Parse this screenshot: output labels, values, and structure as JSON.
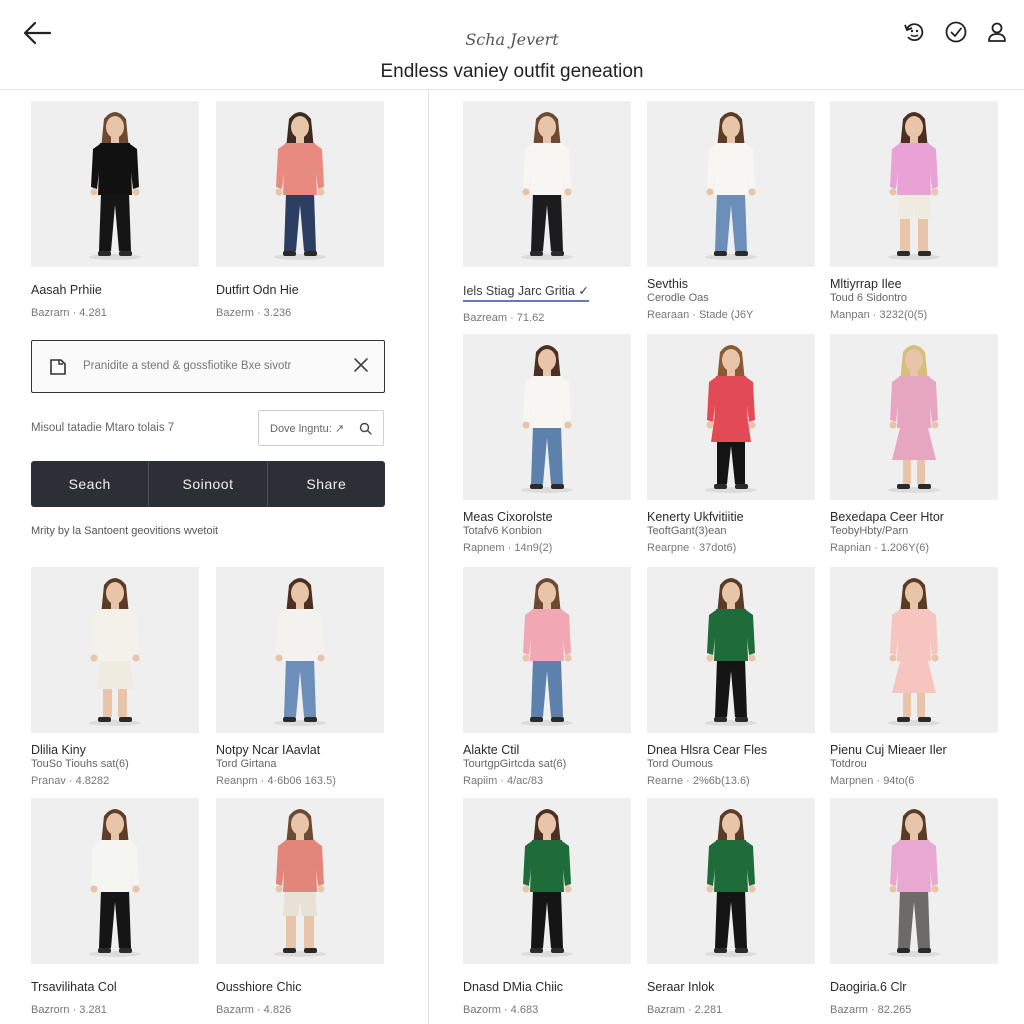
{
  "header": {
    "subtitle": "Scha Jevert",
    "title": "Endless vaniey outfit geneation"
  },
  "left_column": {
    "cards_top": [
      {
        "name": "Aasah Prhiie",
        "meta": "Bazrarn · 4.281",
        "top": "#111111",
        "bottom": "#151515",
        "hair": "#6b4a33",
        "style": "pants"
      },
      {
        "name": "Dutfirt Odn Hie",
        "meta": "Bazerm · 3.236",
        "top": "#e98a80",
        "bottom": "#2c3f63",
        "hair": "#3d2a20",
        "style": "pants"
      }
    ],
    "search": {
      "placeholder": "Pranidite a stend & gossfiotike Bxe sivotr"
    },
    "filter": {
      "label": "Misoul tatadie Mtaro tolais 7",
      "input_placeholder": "Dove lngntu: ↗"
    },
    "segmented_buttons": [
      "Seach",
      "Soinoot",
      "Share"
    ],
    "note": "Mrity by la Santoent geovitions wvetoit",
    "cards_bottom": [
      {
        "name": "Dlilia Kiny",
        "line2": "TouSo Tiouhs  sat(6)",
        "meta": "Pranav · 4.8282",
        "top": "#f4f1ea",
        "bottom": "#efebe1",
        "hair": "#5a3b26",
        "style": "skirt"
      },
      {
        "name": "Notpy Ncar IAavlat",
        "line2": "Tord Girtana",
        "meta": "Reanpm · 4·6b06  163.5)",
        "top": "#f3f2ee",
        "bottom": "#6b8fb8",
        "hair": "#4a2f22",
        "style": "pants"
      },
      {
        "name": "Trsavilihata Col",
        "meta": "Bazrorn · 3.281",
        "top": "#f5f5f2",
        "bottom": "#151515",
        "hair": "#5e3d2a",
        "style": "pants"
      },
      {
        "name": "Ousshiore Chic",
        "meta": "Bazarm · 4.826",
        "top": "#e2857a",
        "bottom": "#e8e2d6",
        "hair": "#6b4a33",
        "style": "shorts"
      }
    ]
  },
  "right_column": {
    "cards": [
      {
        "name": "Iels Stiag Jarc Gritia ✓",
        "meta": "Bazream · 71.62",
        "top": "#f7f6f3",
        "bottom": "#1c1c1f",
        "hair": "#6b4a33",
        "style": "pants",
        "underlined": true
      },
      {
        "name": "Sevthis",
        "line2": "Cerodle Oas",
        "meta": "Rearaan · Stade (J6Y",
        "top": "#f7f6f3",
        "bottom": "#6b8fb8",
        "hair": "#5a3b26",
        "style": "pants"
      },
      {
        "name": "Mltiyrrap Ilee",
        "line2": "Toud 6 Sidontro",
        "meta": "Manpan · 3232(0(5)",
        "top": "#e9a2d6",
        "bottom": "#efebe1",
        "hair": "#4a2f22",
        "style": "shorts"
      },
      {
        "name": "Meas Cixorolste",
        "line2": "Totafv6 Konbion",
        "meta": "Rapnem · 14n9(2)",
        "top": "#f7f6f3",
        "bottom": "#5d81ad",
        "hair": "#4a2f22",
        "style": "pants"
      },
      {
        "name": "Kenerty Ukfvitiitie",
        "line2": "TeoftGant(3)ean",
        "meta": "Rearpne · 37dot6)",
        "top": "#e24a55",
        "bottom": "#141414",
        "hair": "#8a5a33",
        "style": "tunic"
      },
      {
        "name": "Bexedapa Ceer Htor",
        "line2": "TeobyHbty/Parn",
        "meta": "Rapnian · 1.206Y(6)",
        "top": "#e6a6c0",
        "bottom": "#e6a6c0",
        "hair": "#d9bd7a",
        "style": "dress"
      },
      {
        "name": "Alakte Ctil",
        "line2": "TourtgpGirtcda  sat(6)",
        "meta": "Rapiim · 4/ac/83",
        "top": "#f2a7b4",
        "bottom": "#5d81ad",
        "hair": "#6b4a33",
        "style": "pants"
      },
      {
        "name": "Dnea Hlsra Cear Fles",
        "line2": "Tord Oumous",
        "meta": "Rearne · 2%6b(13.6)",
        "top": "#1f6b3a",
        "bottom": "#151515",
        "hair": "#5a3b26",
        "style": "pants"
      },
      {
        "name": "Pienu Cuj Mieaer Iler",
        "line2": "Totdrou",
        "meta": "Marpnen · 94to(6",
        "top": "#f6c5c0",
        "bottom": "#f6c5c0",
        "hair": "#5a3b26",
        "style": "dress"
      },
      {
        "name": "Dnasd DMia Chiic",
        "meta": "Bazorm · 4.683",
        "top": "#1f6b3a",
        "bottom": "#151515",
        "hair": "#4a2f22",
        "style": "pants"
      },
      {
        "name": "Seraar Inlok",
        "meta": "Bazram · 2.281",
        "top": "#1f6b3a",
        "bottom": "#151515",
        "hair": "#5a3b26",
        "style": "pants"
      },
      {
        "name": "Daogiria.6 Clr",
        "meta": "Bazarm · 82.265",
        "top": "#e8a8d2",
        "bottom": "#6d6a6a",
        "hair": "#5a3b26",
        "style": "pants"
      }
    ]
  },
  "icons": {
    "back": "arrow-left-icon",
    "top_right": [
      "refresh-face-icon",
      "check-circle-icon",
      "user-icon"
    ],
    "search_box": "note-icon",
    "clear": "close-icon",
    "small_search": "search-icon"
  }
}
